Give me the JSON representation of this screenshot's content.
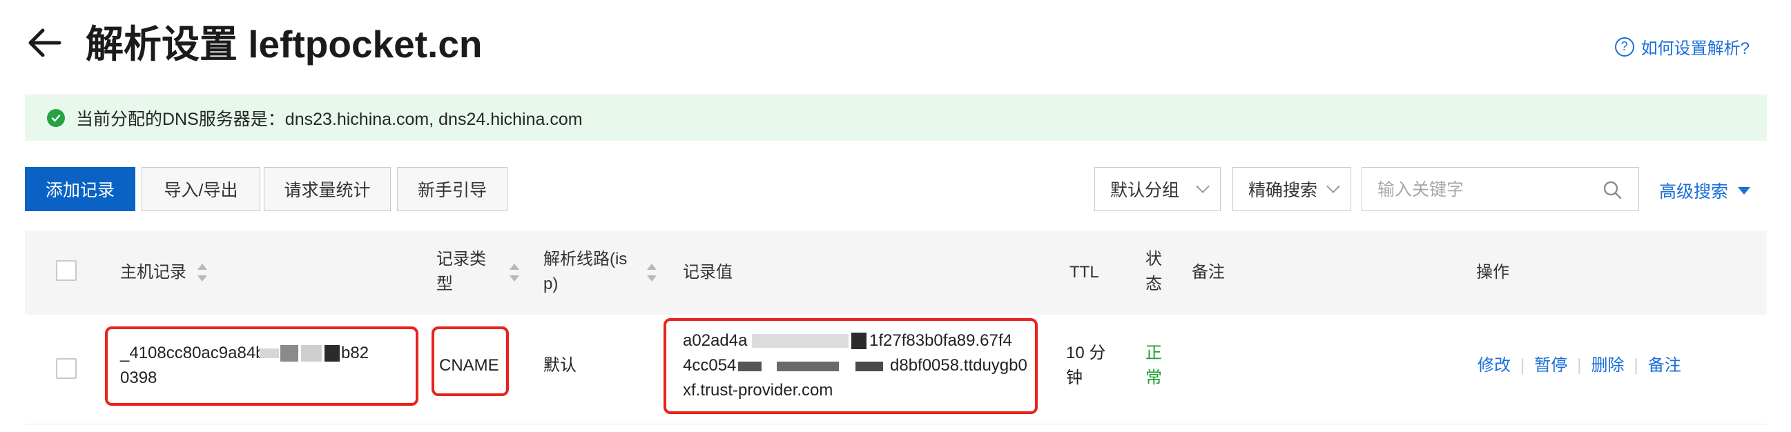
{
  "header": {
    "title": "解析设置 leftpocket.cn",
    "help_link": "如何设置解析?",
    "icons": {
      "back": "arrow-left-icon",
      "help": "question-circle-icon"
    }
  },
  "banner": {
    "text": "当前分配的DNS服务器是：dns23.hichina.com, dns24.hichina.com",
    "icon": "check-circle-icon",
    "status_color": "#25a244",
    "background": "#e8f8ec"
  },
  "toolbar": {
    "add_record": "添加记录",
    "import_export": "导入/导出",
    "request_stats": "请求量统计",
    "beginner_guide": "新手引导",
    "group_select": "默认分组",
    "match_select": "精确搜索",
    "search_placeholder": "输入关键字",
    "advanced_search": "高级搜索",
    "accent_color": "#0a62c4"
  },
  "table": {
    "columns": {
      "host": "主机记录",
      "type_line1": "记录类",
      "type_line2": "型",
      "line_line1": "解析线路(is",
      "line_line2": "p)",
      "value": "记录值",
      "ttl": "TTL",
      "status_line1": "状",
      "status_line2": "态",
      "remark": "备注",
      "actions": "操作"
    },
    "rows": [
      {
        "host_line1_a": "_4108cc80ac9a84b",
        "host_line1_b": "b82",
        "host_line2": "0398",
        "type": "CNAME",
        "line": "默认",
        "value_line1_a": "a02ad4a",
        "value_line1_b": "1f27f83b0fa89.67f4",
        "value_line2_a": "4cc054",
        "value_line2_b": "d8bf0058.ttduygb0",
        "value_line3": "xf.trust-provider.com",
        "ttl_line1": "10 分",
        "ttl_line2": "钟",
        "status_line1": "正",
        "status_line2": "常",
        "actions": {
          "edit": "修改",
          "pause": "暂停",
          "delete": "删除",
          "remark": "备注"
        },
        "status_color": "#1e9e2e",
        "highlight_color": "#e8231e"
      }
    ]
  }
}
